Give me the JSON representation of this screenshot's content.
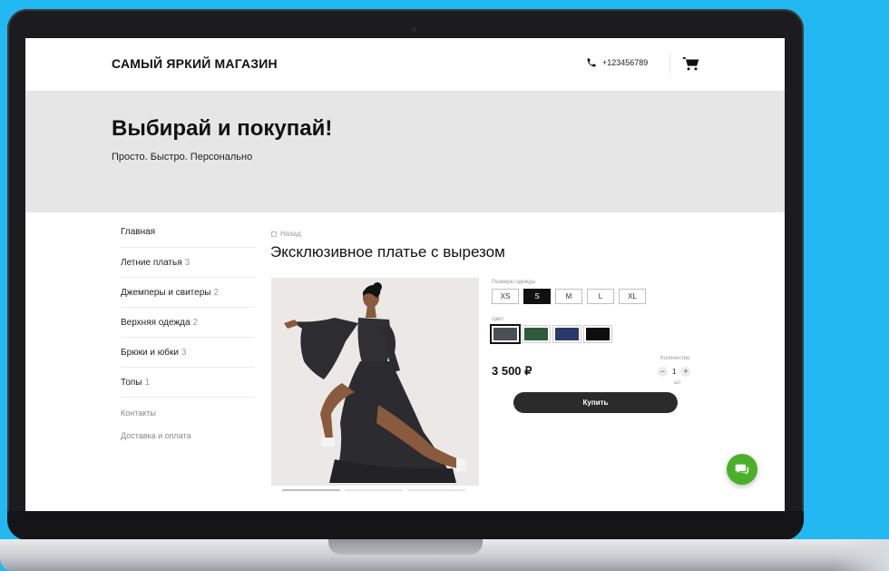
{
  "header": {
    "brand": "САМЫЙ ЯРКИЙ МАГАЗИН",
    "phone": "+123456789",
    "phone_icon": "phone-icon",
    "cart_icon": "cart-icon"
  },
  "hero": {
    "title": "Выбирай и покупай!",
    "subtitle": "Просто. Быстро. Персонально"
  },
  "sidebar": {
    "items": [
      {
        "label": "Главная",
        "count": ""
      },
      {
        "label": "Летние платья",
        "count": "3"
      },
      {
        "label": "Джемперы и свитеры",
        "count": "2"
      },
      {
        "label": "Верхняя одежда",
        "count": "2"
      },
      {
        "label": "Брюки и юбки",
        "count": "3"
      },
      {
        "label": "Топы",
        "count": "1"
      }
    ],
    "links": [
      "Контакты",
      "Доставка и оплата"
    ]
  },
  "product": {
    "back_label": "Назад",
    "title": "Эксклюзивное платье с вырезом",
    "sizes_label": "Размеры одежды",
    "sizes": [
      "XS",
      "S",
      "M",
      "L",
      "XL"
    ],
    "selected_size": "S",
    "color_label": "Цвет",
    "colors": [
      "#4b4f57",
      "#2f5a3c",
      "#2c3a6b",
      "#0d0d0d"
    ],
    "price": "3 500 ₽",
    "quantity_label": "Количество",
    "quantity": "1",
    "quantity_unit": "шт",
    "buy_label": "Купить",
    "gallery_active_index": 0,
    "gallery_count": 3
  },
  "chat_icon": "chat-icon",
  "theme": {
    "background": "#22b8f2",
    "accent_green": "#4caf2a"
  }
}
